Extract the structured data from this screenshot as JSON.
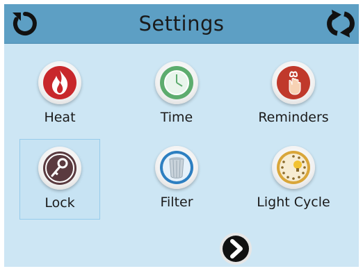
{
  "header": {
    "title": "Settings",
    "back_icon": "back-arrow-icon",
    "refresh_icon": "refresh-icon"
  },
  "tiles": [
    {
      "label": "Heat",
      "icon": "flame-icon",
      "color": "#c8272b"
    },
    {
      "label": "Time",
      "icon": "clock-icon",
      "color": "#5dac6e"
    },
    {
      "label": "Reminders",
      "icon": "reminder-hand-icon",
      "color": "#c0392b"
    },
    {
      "label": "Lock",
      "icon": "key-icon",
      "color": "#5a3a3f",
      "selected": true
    },
    {
      "label": "Filter",
      "icon": "filter-cartridge-icon",
      "color": "#2d7fc1"
    },
    {
      "label": "Light Cycle",
      "icon": "light-cycle-icon",
      "color": "#d9a63a"
    }
  ],
  "next_icon": "chevron-right-icon",
  "colors": {
    "header": "#5d9fc4",
    "background": "#cde6f4",
    "selected_border": "#96cbeb"
  }
}
